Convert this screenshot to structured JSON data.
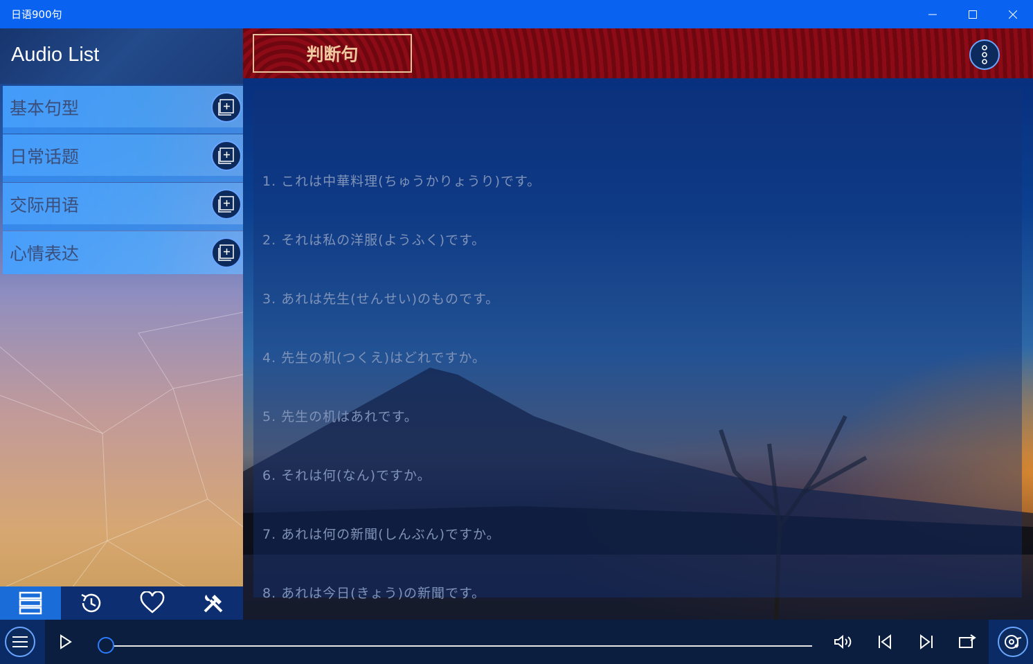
{
  "window": {
    "title": "日语900句"
  },
  "left_panel": {
    "header": "Audio List",
    "categories": [
      {
        "label": "基本句型"
      },
      {
        "label": "日常话题"
      },
      {
        "label": "交际用语"
      },
      {
        "label": "心情表达"
      }
    ],
    "tabs": [
      {
        "icon": "list-icon",
        "active": true
      },
      {
        "icon": "history-icon",
        "active": false
      },
      {
        "icon": "heart-icon",
        "active": false
      },
      {
        "icon": "tools-icon",
        "active": false
      }
    ]
  },
  "main": {
    "section_title": "判断句",
    "sentences": [
      "1. これは中華料理(ちゅうかりょうり)です。",
      "2. それは私の洋服(ようふく)です。",
      "3. あれは先生(せんせい)のものです。",
      "4. 先生の机(つくえ)はどれですか。",
      "5. 先生の机はあれです。",
      "6. それは何(なん)ですか。",
      "7. あれは何の新聞(しんぶん)ですか。",
      "8. あれは今日(きょう)の新聞です。"
    ]
  },
  "player": {
    "progress": 0.0
  },
  "colors": {
    "titlebar": "#0a63f0",
    "banner": "#7d0912",
    "accent": "#2b7cff"
  }
}
